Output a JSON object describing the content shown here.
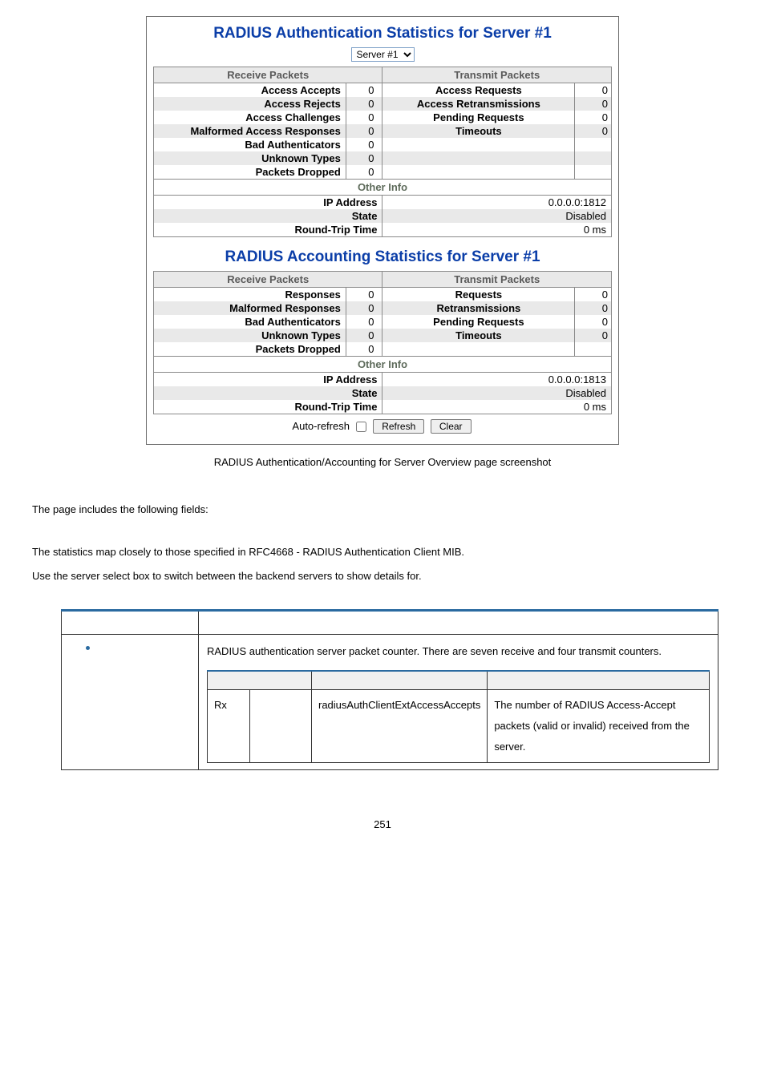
{
  "screenshot": {
    "auth": {
      "title": "RADIUS Authentication Statistics for Server #1",
      "server_select": "Server #1",
      "recv_head": "Receive Packets",
      "tx_head": "Transmit Packets",
      "rows": {
        "r1": {
          "recv_lbl": "Access Accepts",
          "recv_val": "0",
          "tx_lbl": "Access Requests",
          "tx_val": "0"
        },
        "r2": {
          "recv_lbl": "Access Rejects",
          "recv_val": "0",
          "tx_lbl": "Access Retransmissions",
          "tx_val": "0"
        },
        "r3": {
          "recv_lbl": "Access Challenges",
          "recv_val": "0",
          "tx_lbl": "Pending Requests",
          "tx_val": "0"
        },
        "r4": {
          "recv_lbl": "Malformed Access Responses",
          "recv_val": "0",
          "tx_lbl": "Timeouts",
          "tx_val": "0"
        },
        "r5": {
          "recv_lbl": "Bad Authenticators",
          "recv_val": "0"
        },
        "r6": {
          "recv_lbl": "Unknown Types",
          "recv_val": "0"
        },
        "r7": {
          "recv_lbl": "Packets Dropped",
          "recv_val": "0"
        }
      },
      "other_head": "Other Info",
      "info": {
        "ip_lbl": "IP Address",
        "ip_val": "0.0.0.0:1812",
        "state_lbl": "State",
        "state_val": "Disabled",
        "rtt_lbl": "Round-Trip Time",
        "rtt_val": "0 ms"
      }
    },
    "acct": {
      "title": "RADIUS Accounting Statistics for Server #1",
      "recv_head": "Receive Packets",
      "tx_head": "Transmit Packets",
      "rows": {
        "r1": {
          "recv_lbl": "Responses",
          "recv_val": "0",
          "tx_lbl": "Requests",
          "tx_val": "0"
        },
        "r2": {
          "recv_lbl": "Malformed Responses",
          "recv_val": "0",
          "tx_lbl": "Retransmissions",
          "tx_val": "0"
        },
        "r3": {
          "recv_lbl": "Bad Authenticators",
          "recv_val": "0",
          "tx_lbl": "Pending Requests",
          "tx_val": "0"
        },
        "r4": {
          "recv_lbl": "Unknown Types",
          "recv_val": "0",
          "tx_lbl": "Timeouts",
          "tx_val": "0"
        },
        "r5": {
          "recv_lbl": "Packets Dropped",
          "recv_val": "0"
        }
      },
      "other_head": "Other Info",
      "info": {
        "ip_lbl": "IP Address",
        "ip_val": "0.0.0.0:1813",
        "state_lbl": "State",
        "state_val": "Disabled",
        "rtt_lbl": "Round-Trip Time",
        "rtt_val": "0 ms"
      }
    },
    "controls": {
      "auto_refresh": "Auto-refresh",
      "refresh": "Refresh",
      "clear": "Clear"
    }
  },
  "caption": "RADIUS Authentication/Accounting for Server Overview page screenshot",
  "para1": "The page includes the following fields:",
  "para2": "The statistics map closely to those specified in RFC4668 - RADIUS Authentication Client MIB.",
  "para3": "Use the server select box to switch between the backend servers to show details for.",
  "desc_intro": "RADIUS authentication server packet counter. There are seven receive and four transmit counters.",
  "inner_row": {
    "c1": "Rx",
    "c3": "radiusAuthClientExtAccessAccepts",
    "c4": "The number of RADIUS Access-Accept packets (valid or invalid) received from the server."
  },
  "page_number": "251"
}
